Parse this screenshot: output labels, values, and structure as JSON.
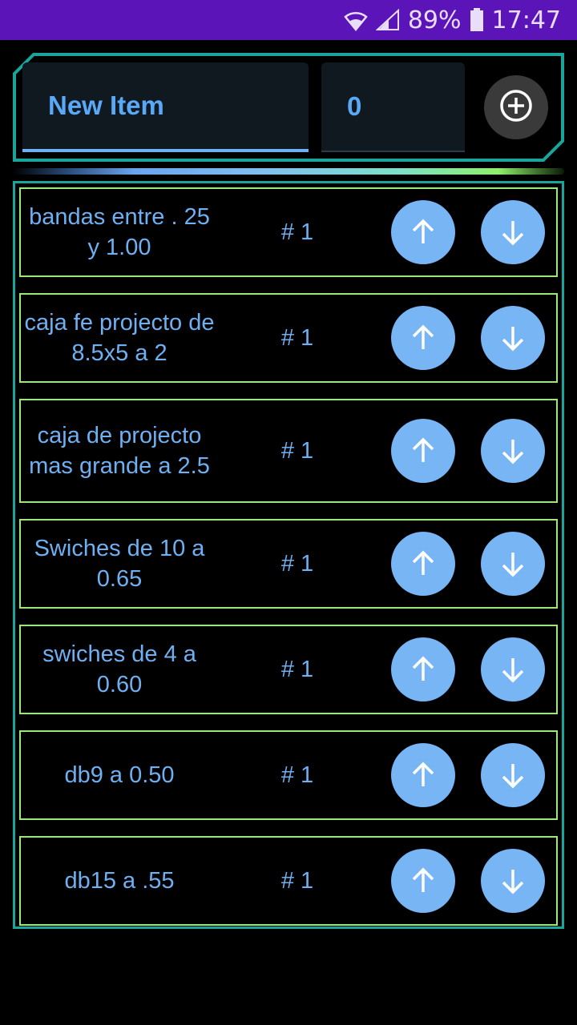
{
  "status_bar": {
    "battery_percent": "89%",
    "time": "17:47",
    "icons": [
      "wifi-icon",
      "signal-icon",
      "battery-icon"
    ],
    "background": "#5b14b8"
  },
  "header": {
    "name_input": {
      "value": "New Item"
    },
    "quantity_input": {
      "value": "0"
    },
    "add_button": {
      "icon": "add-circle-icon"
    }
  },
  "colors": {
    "accent_blue": "#6fb0f2",
    "button_blue": "#77b5f5",
    "row_border_green": "#9ae87a",
    "panel_border_teal": "#1aa59a"
  },
  "items": [
    {
      "name": "bandas entre . 25 y 1.00",
      "qty": "# 1"
    },
    {
      "name": "caja fe projecto de 8.5x5 a 2",
      "qty": "# 1"
    },
    {
      "name": "caja de projecto mas grande a 2.5",
      "qty": "# 1"
    },
    {
      "name": "Swiches de 10 a 0.65",
      "qty": "# 1"
    },
    {
      "name": "swiches de 4 a 0.60",
      "qty": "# 1"
    },
    {
      "name": "db9 a 0.50",
      "qty": "# 1"
    },
    {
      "name": "db15 a .55",
      "qty": "# 1"
    }
  ],
  "row_actions": {
    "up_icon": "arrow-up-icon",
    "down_icon": "arrow-down-icon"
  }
}
